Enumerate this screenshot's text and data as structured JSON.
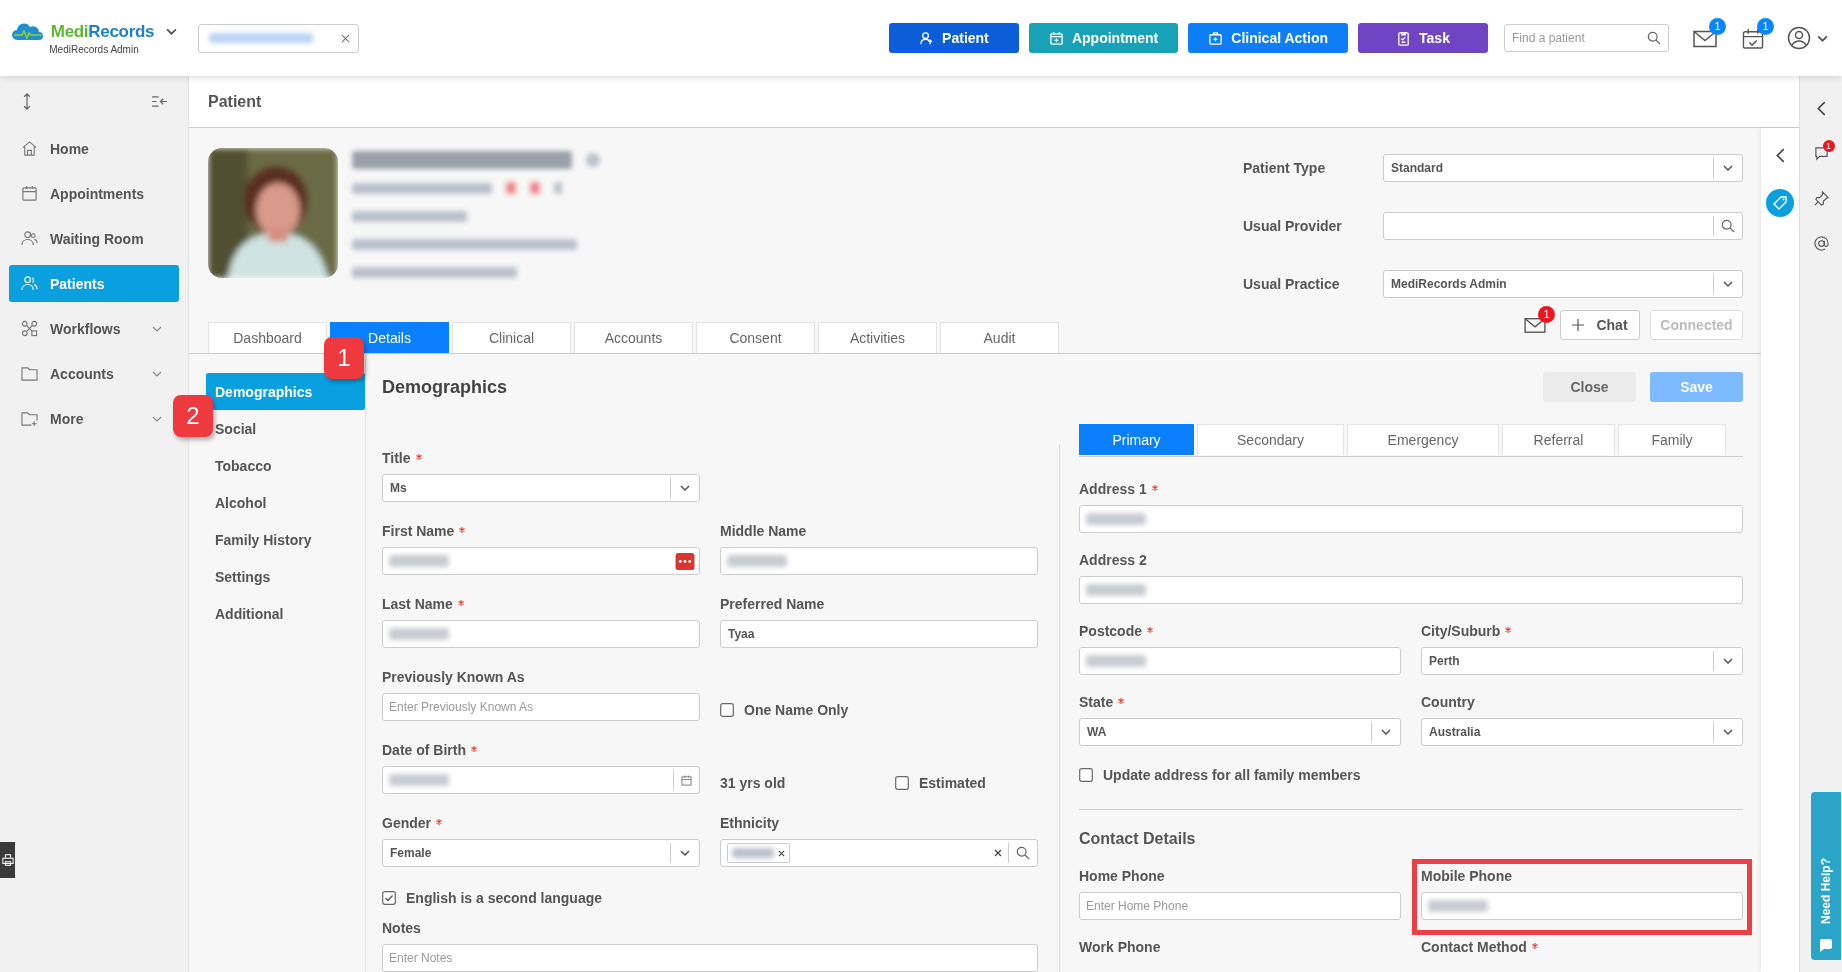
{
  "app": {
    "logo_parts": [
      "Medi",
      "Records"
    ],
    "subtitle": "MediRecords Admin"
  },
  "top_actions": [
    {
      "label": "Patient",
      "color": "#0b5ed7"
    },
    {
      "label": "Appointment",
      "color": "#17a2b8"
    },
    {
      "label": "Clinical Action",
      "color": "#0d7ef5"
    },
    {
      "label": "Task",
      "color": "#7045c4"
    }
  ],
  "search": {
    "placeholder": "Find a patient"
  },
  "notifications": [
    {
      "kind": "mail",
      "badge": "1"
    },
    {
      "kind": "calendar",
      "badge": "1"
    }
  ],
  "sidebar": {
    "items": [
      {
        "label": "Home",
        "selected": false,
        "expandable": false
      },
      {
        "label": "Appointments",
        "selected": false,
        "expandable": false
      },
      {
        "label": "Waiting Room",
        "selected": false,
        "expandable": false
      },
      {
        "label": "Patients",
        "selected": true,
        "expandable": false
      },
      {
        "label": "Workflows",
        "selected": false,
        "expandable": true
      },
      {
        "label": "Accounts",
        "selected": false,
        "expandable": true
      },
      {
        "label": "More",
        "selected": false,
        "expandable": true
      }
    ]
  },
  "page_title": "Patient",
  "patient_fields": [
    {
      "label": "Patient Type",
      "kind": "select",
      "value": "Standard"
    },
    {
      "label": "Usual Provider",
      "kind": "search"
    },
    {
      "label": "Usual Practice",
      "kind": "select",
      "value": "MediRecords Admin"
    }
  ],
  "chat": {
    "badge": "1",
    "chat_label": "Chat",
    "connected": {
      "label": "Connected",
      "disabled": true
    }
  },
  "tabs": [
    {
      "label": "Dashboard",
      "selected": false
    },
    {
      "label": "Details",
      "selected": true
    },
    {
      "label": "Clinical",
      "selected": false
    },
    {
      "label": "Accounts",
      "selected": false
    },
    {
      "label": "Consent",
      "selected": false
    },
    {
      "label": "Activities",
      "selected": false
    },
    {
      "label": "Audit",
      "selected": false
    }
  ],
  "subnav": [
    {
      "label": "Demographics",
      "selected": true
    },
    {
      "label": "Social",
      "selected": false
    },
    {
      "label": "Tobacco",
      "selected": false
    },
    {
      "label": "Alcohol",
      "selected": false
    },
    {
      "label": "Family History",
      "selected": false
    },
    {
      "label": "Settings",
      "selected": false
    },
    {
      "label": "Additional",
      "selected": false
    }
  ],
  "section_title": "Demographics",
  "buttons": [
    {
      "label": "Close",
      "kind": "secondary",
      "disabled": false
    },
    {
      "label": "Save",
      "kind": "primary",
      "disabled": true
    }
  ],
  "demographics": [
    [
      {
        "kind": "select",
        "label": "Title",
        "required": true,
        "value": "Ms"
      }
    ],
    [
      {
        "kind": "text",
        "label": "First Name",
        "required": true,
        "blurred": true,
        "alert": true
      },
      {
        "kind": "text",
        "label": "Middle Name",
        "blurred": true
      }
    ],
    [
      {
        "kind": "text",
        "label": "Last Name",
        "required": true,
        "blurred": true
      },
      {
        "kind": "text",
        "label": "Preferred Name",
        "value": "Tyaa"
      }
    ],
    [
      {
        "kind": "text",
        "label": "Previously Known As",
        "placeholder": "Enter Previously Known As"
      },
      {
        "kind": "check",
        "label": "One Name Only",
        "checked": false
      }
    ],
    [
      {
        "kind": "date",
        "label": "Date of Birth",
        "required": true,
        "blurred": true
      },
      {
        "kind": "age",
        "text": "31 yrs old",
        "check": {
          "label": "Estimated",
          "checked": false
        }
      }
    ],
    [
      {
        "kind": "select",
        "label": "Gender",
        "required": true,
        "value": "Female"
      },
      {
        "kind": "tags",
        "label": "Ethnicity",
        "blurred": true
      }
    ],
    [
      {
        "kind": "check",
        "label": "English is a second language",
        "checked": true,
        "wide": true
      }
    ],
    [
      {
        "kind": "text",
        "label": "Notes",
        "placeholder": "Enter Notes",
        "wide": true
      }
    ]
  ],
  "address_tabs": [
    {
      "label": "Primary",
      "selected": true
    },
    {
      "label": "Secondary",
      "selected": false
    },
    {
      "label": "Emergency",
      "selected": false
    },
    {
      "label": "Referral",
      "selected": false
    },
    {
      "label": "Family",
      "selected": false
    }
  ],
  "address": [
    [
      {
        "kind": "text",
        "label": "Address 1",
        "required": true,
        "blurred": true,
        "wide": true
      }
    ],
    [
      {
        "kind": "text",
        "label": "Address 2",
        "blurred": true,
        "wide": true
      }
    ],
    [
      {
        "kind": "text",
        "label": "Postcode",
        "required": true,
        "blurred": true
      },
      {
        "kind": "select",
        "label": "City/Suburb",
        "required": true,
        "value": "Perth"
      }
    ],
    [
      {
        "kind": "select",
        "label": "State",
        "required": true,
        "value": "WA"
      },
      {
        "kind": "select",
        "label": "Country",
        "value": "Australia"
      }
    ],
    [
      {
        "kind": "check",
        "label": "Update address for all family members",
        "checked": false,
        "wide": true
      }
    ]
  ],
  "contact_title": "Contact Details",
  "contact": [
    [
      {
        "kind": "text",
        "label": "Home Phone",
        "placeholder": "Enter Home Phone"
      },
      {
        "kind": "text",
        "label": "Mobile Phone",
        "blurred": true,
        "highlighted": true
      }
    ],
    [
      {
        "kind": "label",
        "label": "Work Phone"
      },
      {
        "kind": "label",
        "label": "Contact Method",
        "required": true
      }
    ]
  ],
  "annotations": [
    {
      "label": "1"
    },
    {
      "label": "2"
    }
  ],
  "side_rail": {
    "chat_badge": "1"
  },
  "help_tab": "Need Help?"
}
